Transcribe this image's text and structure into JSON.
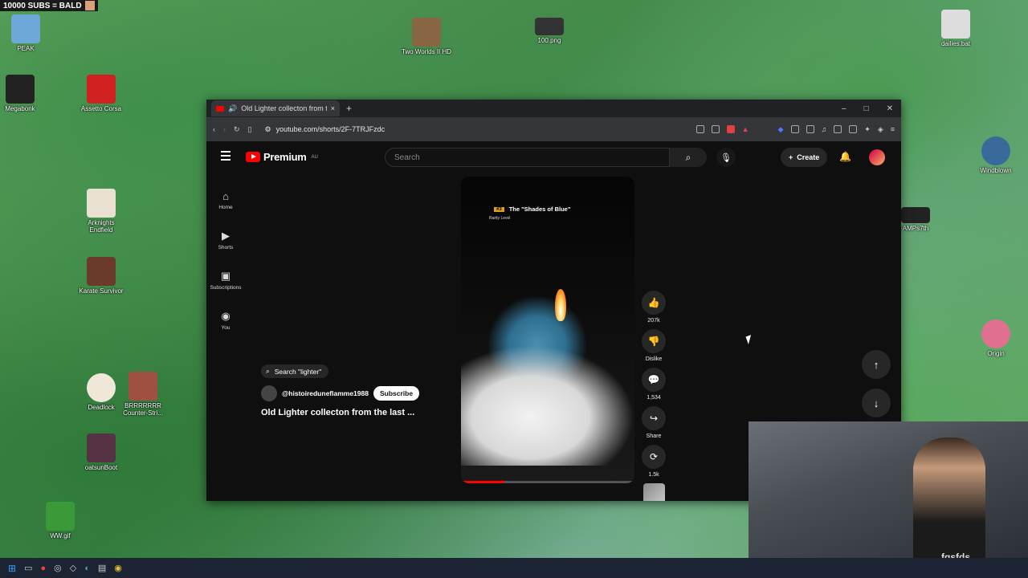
{
  "stream": {
    "title": "10000 SUBS = BALD"
  },
  "desktop_icons": [
    {
      "label": "PEAK",
      "color": "#6ea8d8"
    },
    {
      "label": "Megabonk",
      "color": "#222222"
    },
    {
      "label": "Assetto Corsa",
      "color": "#d02020"
    },
    {
      "label": "Arknights Endfield",
      "color": "#e8e0d0"
    },
    {
      "label": "Karate Survivor",
      "color": "#6a3b2a"
    },
    {
      "label": "Deadlock",
      "color": "#efe7d8"
    },
    {
      "label": "BRRRRRRR Counter-Stri...",
      "color": "#a05040"
    },
    {
      "label": "oatsunBoot",
      "color": "#553344"
    },
    {
      "label": "WW.gif",
      "color": "#3a9a3a"
    },
    {
      "label": "Two Worlds II HD",
      "color": "#886644"
    },
    {
      "label": "100.png",
      "color": "#333333"
    },
    {
      "label": "dailies.bat",
      "color": "#dddddd"
    },
    {
      "label": "Windblown",
      "color": "#3a6a9a"
    },
    {
      "label": "AMPs7th",
      "color": "#222222"
    },
    {
      "label": "Origin",
      "color": "#e07090"
    }
  ],
  "browser": {
    "tab_title": "Old Lighter collecton from the",
    "tab_close": "×",
    "new_tab": "+",
    "url": "youtube.com/shorts/2F-7TRJFzdc",
    "window_controls": [
      "–",
      "□",
      "✕"
    ]
  },
  "youtube": {
    "logo_text": "Premium",
    "region": "AU",
    "search_placeholder": "Search",
    "create_label": "Create",
    "guide": [
      {
        "label": "Home",
        "icon": "home-icon",
        "glyph": "⌂"
      },
      {
        "label": "Shorts",
        "icon": "shorts-icon",
        "glyph": "▶"
      },
      {
        "label": "Subscriptions",
        "icon": "subscriptions-icon",
        "glyph": "▣"
      },
      {
        "label": "You",
        "icon": "you-icon",
        "glyph": "◉"
      }
    ],
    "short": {
      "rank": "#3",
      "headline": "The \"Shades of Blue\"",
      "rarity": "Rarity Level",
      "progress": 0.25
    },
    "search_chip": "Search \"lighter\"",
    "channel": "@histoireduneflamme1988",
    "subscribe_label": "Subscribe",
    "video_title": "Old Lighter collecton from the last ...",
    "actions": [
      {
        "name": "like",
        "glyph": "👍",
        "label": "207k"
      },
      {
        "name": "dislike",
        "glyph": "👎",
        "label": "Dislike"
      },
      {
        "name": "comments",
        "glyph": "💬",
        "label": "1,534"
      },
      {
        "name": "share",
        "glyph": "↪",
        "label": "Share"
      },
      {
        "name": "remix",
        "glyph": "⟳",
        "label": "1.5k"
      }
    ],
    "nav": {
      "up": "↑",
      "down": "↓"
    }
  },
  "webcam": {
    "shirt_text": "fgsfds"
  },
  "colors": {
    "brand_red": "#ff0000",
    "bg": "#0f0f0f",
    "chip": "#272727"
  }
}
